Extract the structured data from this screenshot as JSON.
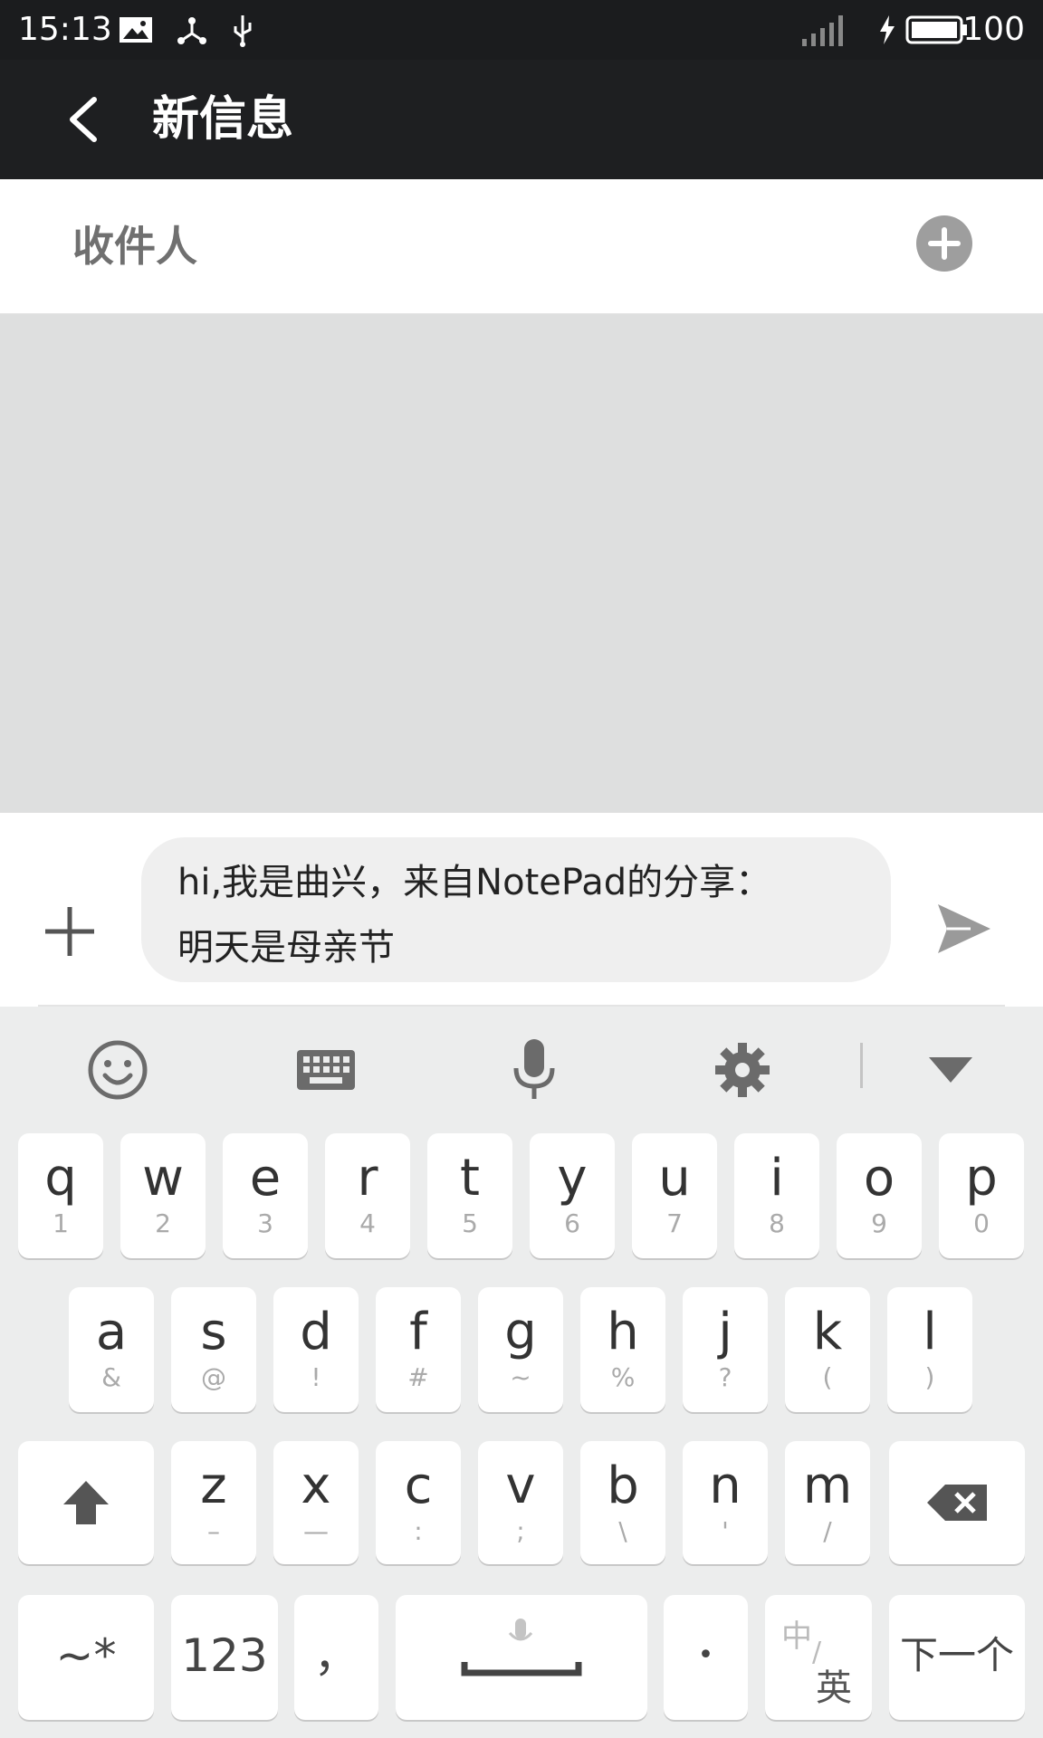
{
  "status_bar": {
    "time": "15:13",
    "battery": "100"
  },
  "header": {
    "title": "新信息"
  },
  "recipient": {
    "label": "收件人"
  },
  "compose": {
    "message": "hi,我是曲兴，来自NotePad的分享：\n明天是母亲节"
  },
  "keyboard": {
    "row1": [
      {
        "main": "q",
        "sub": "1"
      },
      {
        "main": "w",
        "sub": "2"
      },
      {
        "main": "e",
        "sub": "3"
      },
      {
        "main": "r",
        "sub": "4"
      },
      {
        "main": "t",
        "sub": "5"
      },
      {
        "main": "y",
        "sub": "6"
      },
      {
        "main": "u",
        "sub": "7"
      },
      {
        "main": "i",
        "sub": "8"
      },
      {
        "main": "o",
        "sub": "9"
      },
      {
        "main": "p",
        "sub": "0"
      }
    ],
    "row2": [
      {
        "main": "a",
        "sub": "&"
      },
      {
        "main": "s",
        "sub": "@"
      },
      {
        "main": "d",
        "sub": "!"
      },
      {
        "main": "f",
        "sub": "#"
      },
      {
        "main": "g",
        "sub": "~"
      },
      {
        "main": "h",
        "sub": "%"
      },
      {
        "main": "j",
        "sub": "?"
      },
      {
        "main": "k",
        "sub": "("
      },
      {
        "main": "l",
        "sub": ")"
      }
    ],
    "row3": [
      {
        "main": "z",
        "sub": "–"
      },
      {
        "main": "x",
        "sub": "—"
      },
      {
        "main": "c",
        "sub": ":"
      },
      {
        "main": "v",
        "sub": ";"
      },
      {
        "main": "b",
        "sub": "\\"
      },
      {
        "main": "n",
        "sub": "'"
      },
      {
        "main": "m",
        "sub": "/"
      }
    ],
    "symbols_label": "~*",
    "numbers_label": "123",
    "comma_label": "，",
    "period_label": "•",
    "lang_top": "中",
    "lang_bottom": "英",
    "next_label": "下一个"
  },
  "icons": [
    "back-arrow-icon",
    "plus-circle-icon",
    "plus-icon",
    "send-icon",
    "emoji-icon",
    "keyboard-icon",
    "microphone-icon",
    "gear-icon",
    "collapse-triangle-icon",
    "shift-icon",
    "backspace-icon"
  ]
}
